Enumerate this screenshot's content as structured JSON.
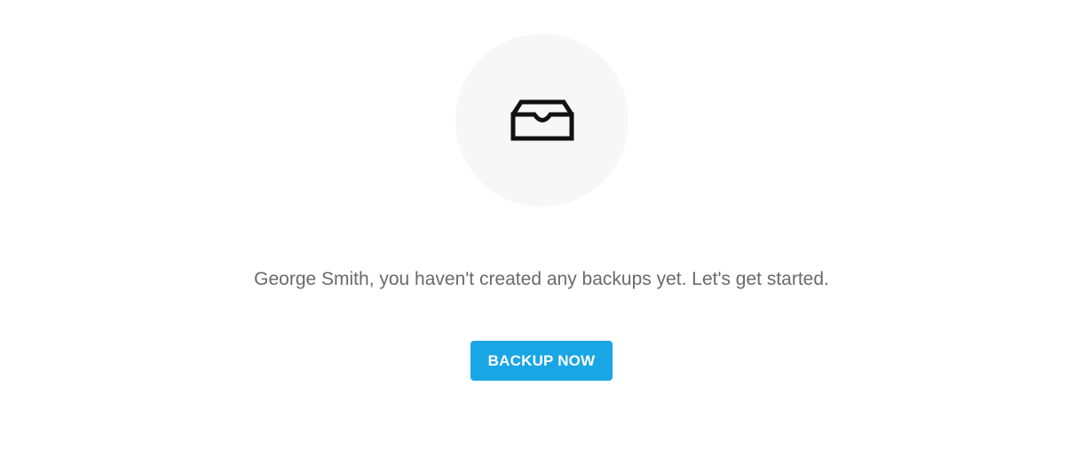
{
  "empty_state": {
    "icon": "inbox-tray-icon",
    "message": "George Smith, you haven't created any backups yet. Let's get started.",
    "button_label": "BACKUP NOW"
  },
  "colors": {
    "accent": "#19a6e4",
    "icon_circle_background": "#f7f7f7",
    "message_text": "#6a6a6a",
    "icon_stroke": "#111111"
  }
}
